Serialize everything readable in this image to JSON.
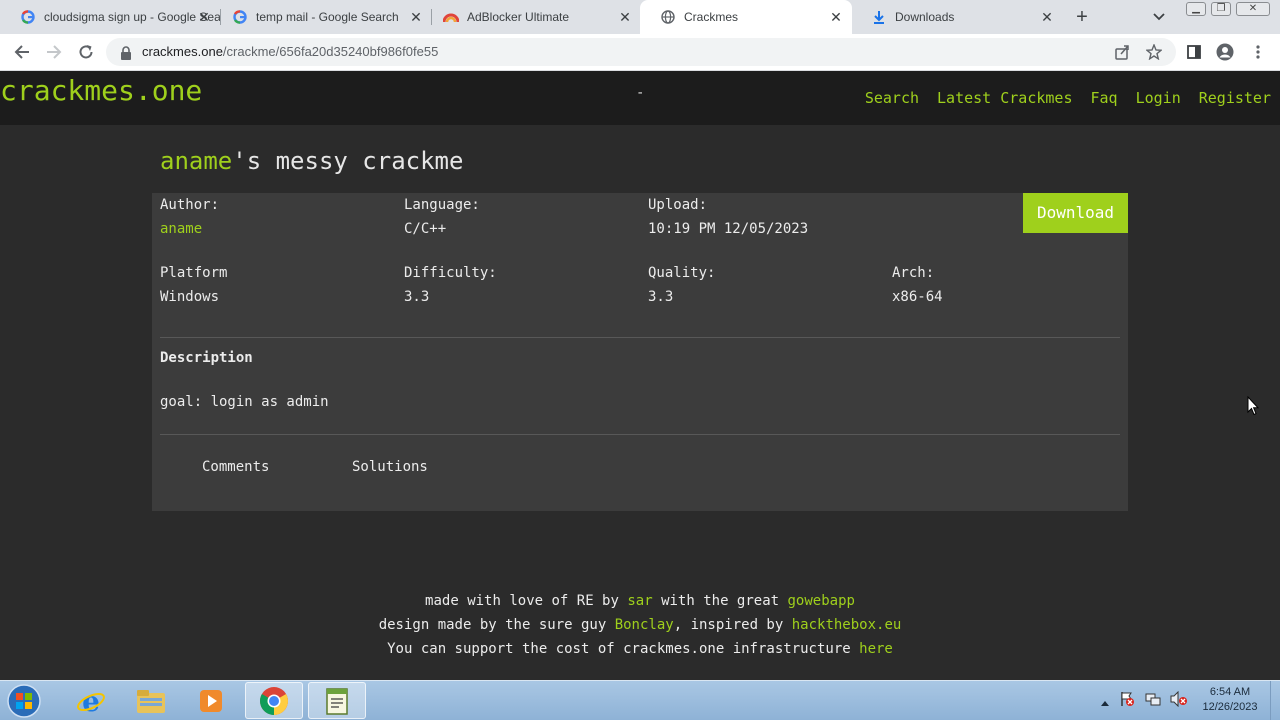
{
  "browser": {
    "tabs": [
      {
        "title": "cloudsigma sign up - Google Search",
        "icon": "google-icon"
      },
      {
        "title": "temp mail - Google Search",
        "icon": "google-icon"
      },
      {
        "title": "AdBlocker Ultimate",
        "icon": "adblocker-icon"
      },
      {
        "title": "Crackmes",
        "icon": "globe-icon",
        "active": true
      },
      {
        "title": "Downloads",
        "icon": "download-icon"
      }
    ],
    "url_domain": "crackmes.one",
    "url_path": "/crackme/656fa20d35240bf986f0fe55"
  },
  "site": {
    "logo": "crackmes.one",
    "separator": "-",
    "nav": [
      "Search",
      "Latest Crackmes",
      "Faq",
      "Login",
      "Register"
    ],
    "accent_color": "#9fd01c"
  },
  "crackme": {
    "author": "aname",
    "title_suffix": "'s messy crackme",
    "labels": {
      "author": "Author:",
      "language": "Language:",
      "upload": "Upload:",
      "platform": "Platform",
      "difficulty": "Difficulty:",
      "quality": "Quality:",
      "arch": "Arch:"
    },
    "values": {
      "author": "aname",
      "language": "C/C++",
      "upload": "10:19 PM 12/05/2023",
      "platform": "Windows",
      "difficulty": "3.3",
      "quality": "3.3",
      "arch": "x86-64"
    },
    "download_label": "Download",
    "description_heading": "Description",
    "description": "goal: login as admin",
    "tabs": [
      "Comments",
      "Solutions"
    ]
  },
  "footer": {
    "line1_a": "made with love of RE by ",
    "line1_sar": "sar",
    "line1_b": " with the great ",
    "line1_gowebapp": "gowebapp",
    "line2_a": "design made by the sure guy ",
    "line2_bonclay": "Bonclay",
    "line2_b": ", inspired by ",
    "line2_htb": "hackthebox.eu",
    "line3_a": "You can support the cost of crackmes.one infrastructure ",
    "line3_here": "here"
  },
  "taskbar": {
    "apps": [
      "internet-explorer-icon",
      "file-explorer-icon",
      "media-player-icon",
      "chrome-icon",
      "notepad-icon"
    ],
    "time": "6:54 AM",
    "date": "12/26/2023"
  }
}
